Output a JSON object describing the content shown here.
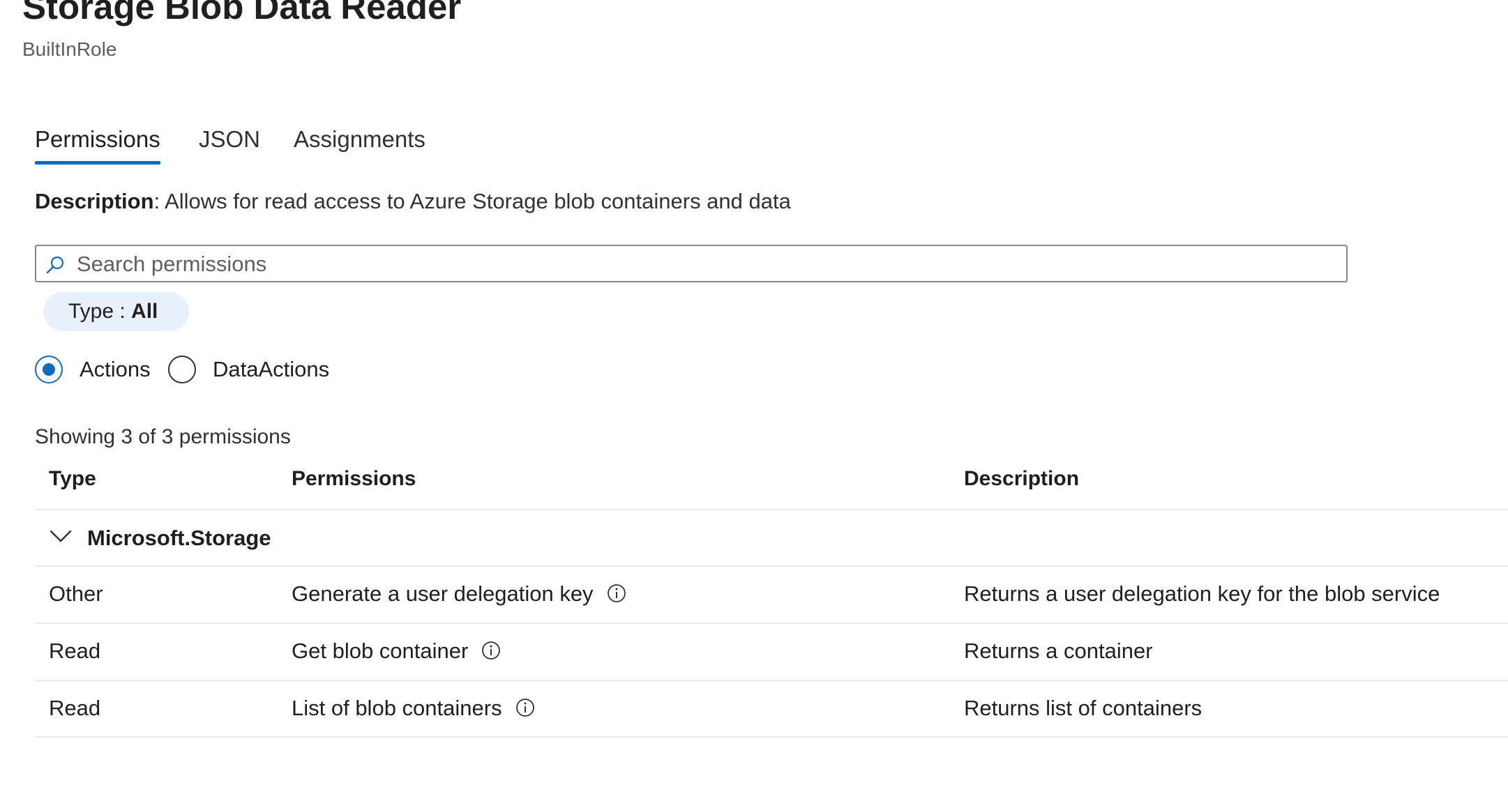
{
  "header": {
    "title": "Storage Blob Data Reader",
    "subtitle": "BuiltInRole"
  },
  "tabs": [
    {
      "label": "Permissions",
      "active": true
    },
    {
      "label": "JSON",
      "active": false
    },
    {
      "label": "Assignments",
      "active": false
    }
  ],
  "description": {
    "label": "Description",
    "text": ": Allows for read access to Azure Storage blob containers and data"
  },
  "search": {
    "placeholder": "Search permissions",
    "value": "",
    "icon": "search-icon"
  },
  "filter_pill": {
    "prefix": "Type : ",
    "value": "All"
  },
  "radio_options": [
    {
      "label": "Actions",
      "checked": true
    },
    {
      "label": "DataActions",
      "checked": false
    }
  ],
  "results_text": "Showing 3 of 3 permissions",
  "table": {
    "columns": [
      "Type",
      "Permissions",
      "Description"
    ],
    "group": {
      "label": "Microsoft.Storage",
      "icon": "chevron-down-icon",
      "expanded": true
    },
    "rows": [
      {
        "type": "Other",
        "permission": "Generate a user delegation key",
        "description": "Returns a user delegation key for the blob service",
        "icon": "info-icon"
      },
      {
        "type": "Read",
        "permission": "Get blob container",
        "description": "Returns a container",
        "icon": "info-icon"
      },
      {
        "type": "Read",
        "permission": "List of blob containers",
        "description": "Returns list of containers",
        "icon": "info-icon"
      }
    ]
  },
  "colors": {
    "accent": "#0f6cbd",
    "pill_background": "#e8f1fb",
    "divider": "#edebe9"
  }
}
